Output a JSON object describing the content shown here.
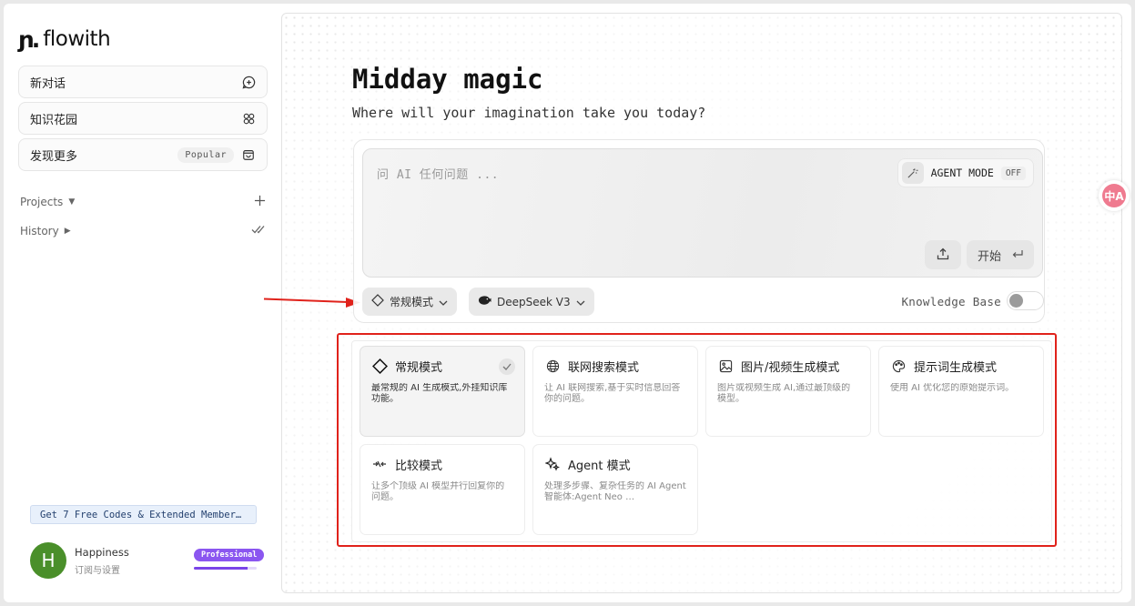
{
  "sidebar": {
    "logo_text": "flowith",
    "items": [
      {
        "label": "新对话",
        "icon": "chat-plus-icon"
      },
      {
        "label": "知识花园",
        "icon": "flower-icon"
      },
      {
        "label": "发现更多",
        "badge": "Popular",
        "icon": "bag-icon"
      }
    ],
    "projects_label": "Projects",
    "history_label": "History",
    "promo_text": "Get 7 Free Codes & Extended Member…",
    "user": {
      "avatar_letter": "H",
      "name": "Happiness",
      "subtitle": "订阅与设置",
      "plan_badge": "Professional",
      "plan_progress": 0.85,
      "avatar_color": "#4a8f2a"
    }
  },
  "main": {
    "title": "Midday magic",
    "subtitle": "Where will your imagination take you today?",
    "input_placeholder": "问 AI 任何问题 ...",
    "agent_mode_label": "AGENT MODE",
    "agent_mode_state": "OFF",
    "start_label": "开始",
    "mode_select_label": "常规模式",
    "model_select_label": "DeepSeek V3",
    "knowledge_base_label": "Knowledge Base",
    "knowledge_base_enabled": false
  },
  "modes": [
    {
      "title": "常规模式",
      "desc": "最常规的 AI 生成模式,外挂知识库功能。",
      "icon": "diamond-icon",
      "selected": true
    },
    {
      "title": "联网搜索模式",
      "desc": "让 AI 联网搜索,基于实时信息回答你的问题。",
      "icon": "globe-icon",
      "selected": false
    },
    {
      "title": "图片/视频生成模式",
      "desc": "图片或视频生成 AI,通过最顶级的模型。",
      "icon": "image-icon",
      "selected": false
    },
    {
      "title": "提示词生成模式",
      "desc": "使用 AI 优化您的原始提示词。",
      "icon": "palette-icon",
      "selected": false
    },
    {
      "title": "比较模式",
      "desc": "让多个顶级 AI 模型并行回复你的问题。",
      "icon": "compare-icon",
      "selected": false
    },
    {
      "title": "Agent 模式",
      "desc": "处理多步骤、复杂任务的 AI Agent 智能体:Agent Neo …",
      "icon": "sparkle-icon",
      "selected": false
    }
  ],
  "translate_widget": {
    "label": "中A"
  },
  "colors": {
    "annotation_red": "#e0221b",
    "plan_purple": "#8b56f0"
  }
}
